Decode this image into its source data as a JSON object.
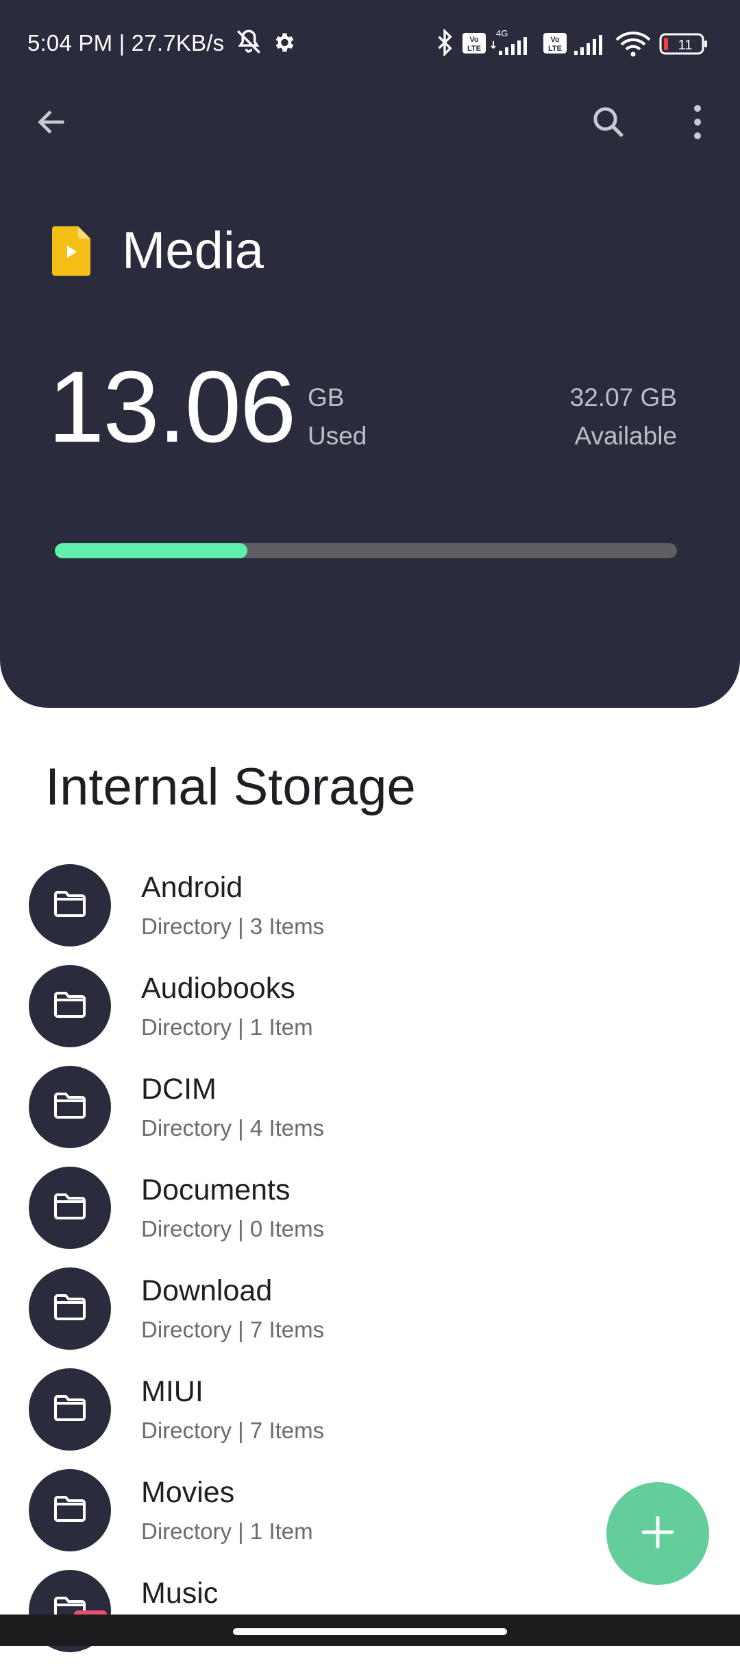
{
  "status_bar": {
    "time_text": "5:04 PM | 27.7KB/s",
    "network_tag": "4G",
    "volte_tag_1": "Vo\nLTE",
    "volte_tag_2": "Vo\nLTE",
    "battery_level": "11",
    "icons": [
      "mute-icon",
      "gear-icon",
      "bluetooth-icon",
      "volte-icon",
      "signal-icon",
      "volte-icon",
      "signal-icon",
      "wifi-icon",
      "battery-icon"
    ]
  },
  "toolbar": {
    "icons": [
      "back-arrow-icon",
      "search-icon",
      "more-vert-icon"
    ]
  },
  "header": {
    "title": "Media",
    "used_value": "13.06",
    "used_unit": "GB",
    "used_label": "Used",
    "available_value": "32.07 GB",
    "available_label": "Available",
    "usage_fraction": 0.31
  },
  "colors": {
    "header_bg": "#2a2b3c",
    "progress_fill": "#5ff0ab",
    "progress_track": "#5f5f63",
    "fab_bg": "#64cd9c",
    "media_icon": "#f4c018"
  },
  "section": {
    "title": "Internal Storage"
  },
  "folders": [
    {
      "name": "Android",
      "meta": "Directory | 3 Items"
    },
    {
      "name": "Audiobooks",
      "meta": "Directory | 1 Item"
    },
    {
      "name": "DCIM",
      "meta": "Directory | 4 Items"
    },
    {
      "name": "Documents",
      "meta": "Directory | 0 Items"
    },
    {
      "name": "Download",
      "meta": "Directory | 7 Items"
    },
    {
      "name": "MIUI",
      "meta": "Directory | 7 Items"
    },
    {
      "name": "Movies",
      "meta": "Directory | 1 Item"
    },
    {
      "name": "Music",
      "meta": ""
    }
  ],
  "fab": {
    "icon": "plus-icon"
  }
}
